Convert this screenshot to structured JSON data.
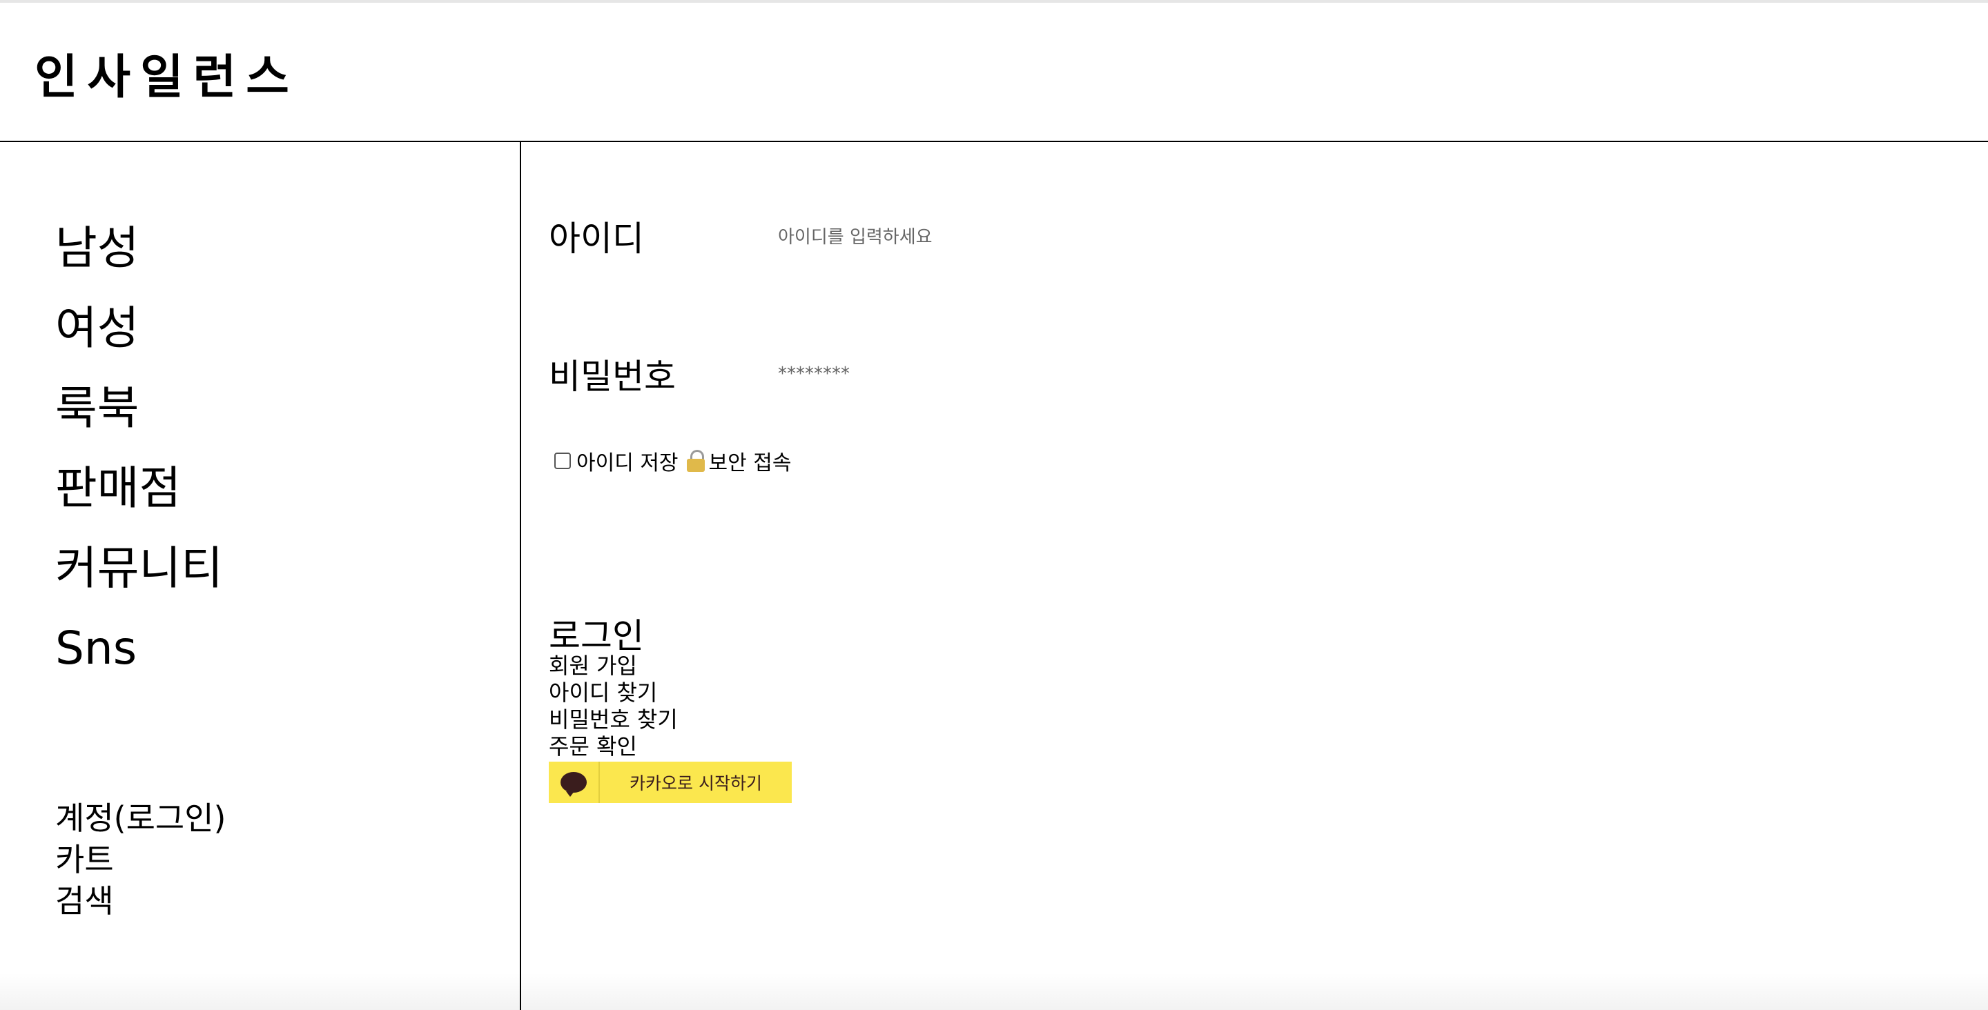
{
  "header": {
    "logo": "인사일런스"
  },
  "sidebar": {
    "nav": [
      "남성",
      "여성",
      "룩북",
      "판매점",
      "커뮤니티",
      "Sns"
    ],
    "utility": [
      "계정(로그인)",
      "카트",
      "검색"
    ]
  },
  "login": {
    "id_label": "아이디",
    "id_placeholder": "아이디를 입력하세요",
    "pw_label": "비밀번호",
    "pw_placeholder": "********",
    "save_id_label": "아이디 저장",
    "secure_label": "보안 접속",
    "login_title": "로그인",
    "links": [
      "회원 가입",
      "아이디 찾기",
      "비밀번호 찾기",
      "주문 확인"
    ],
    "kakao_label": "카카오로 시작하기"
  },
  "colors": {
    "kakao": "#fbe74e",
    "kakao_text": "#3a1d1d"
  }
}
